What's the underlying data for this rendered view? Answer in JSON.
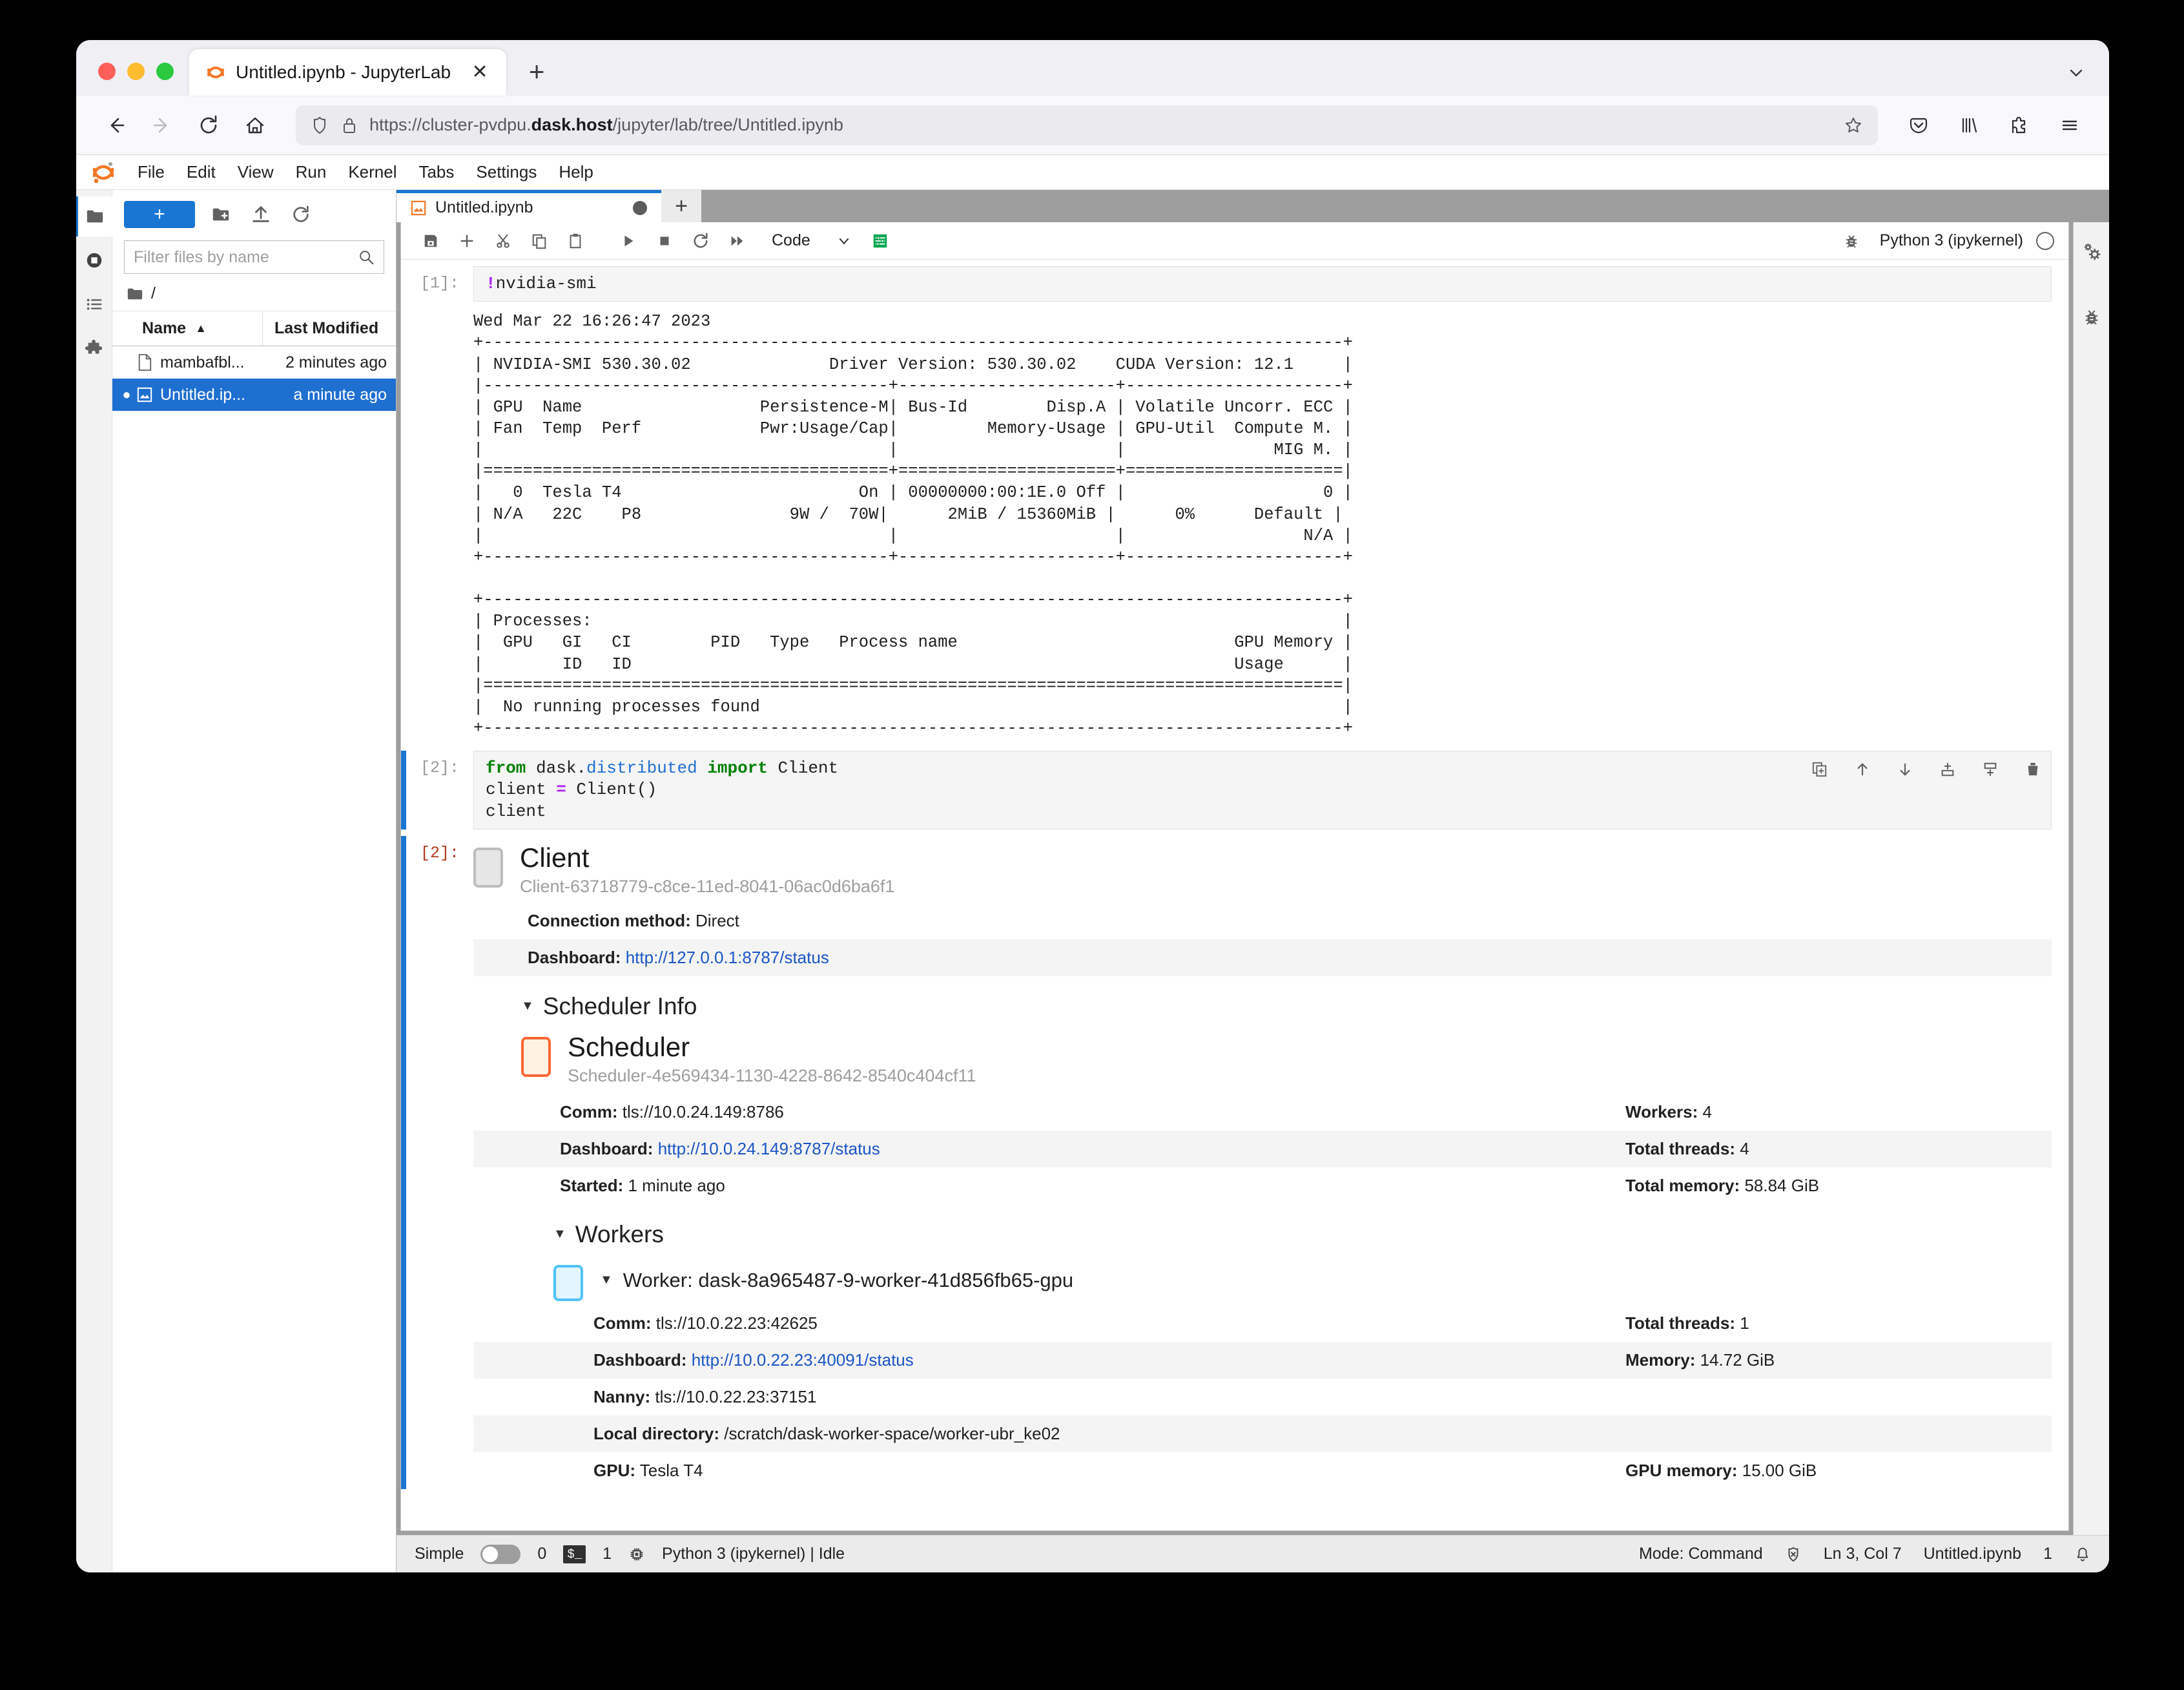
{
  "browser": {
    "tab": {
      "title": "Untitled.ipynb - JupyterLab",
      "favicon": "jupyter-logo-icon",
      "close": "✕"
    },
    "new_tab_label": "+",
    "url_prefix": "https://cluster-pvdpu.",
    "url_bold": "dask.host",
    "url_suffix": "/jupyter/lab/tree/Untitled.ipynb",
    "nav": {
      "back": "back-icon",
      "forward": "forward-icon",
      "reload": "reload-icon",
      "home": "home-icon"
    },
    "toolbar_right": [
      "pocket-icon",
      "library-icon",
      "extensions-icon",
      "app-menu-icon"
    ]
  },
  "jupyter": {
    "menu": [
      "File",
      "Edit",
      "View",
      "Run",
      "Kernel",
      "Tabs",
      "Settings",
      "Help"
    ],
    "left_rail": [
      "folder-icon",
      "running-icon",
      "commands-icon",
      "extensions-icon"
    ],
    "right_rail": [
      "property-inspector-icon",
      "debugger-icon"
    ],
    "filebrowser": {
      "new_button": "+",
      "new_folder_icon": "new-folder-icon",
      "upload_icon": "upload-icon",
      "refresh_icon": "refresh-icon",
      "filter_placeholder": "Filter files by name",
      "filter_value": "",
      "breadcrumb": "/",
      "columns": [
        "Name",
        "Last Modified"
      ],
      "sort_indicator": "▲",
      "files": [
        {
          "name": "mambafbl...",
          "modified": "2 minutes ago",
          "icon": "file-icon",
          "selected": false,
          "dirty": false
        },
        {
          "name": "Untitled.ip...",
          "modified": "a minute ago",
          "icon": "notebook-icon",
          "selected": true,
          "dirty": true
        }
      ]
    },
    "notebook": {
      "tab_label": "Untitled.ipynb",
      "tab_add": "+",
      "toolbar_icons": [
        "save-icon",
        "insert-cell-icon",
        "cut-icon",
        "copy-icon",
        "paste-icon",
        "run-icon",
        "stop-icon",
        "restart-icon",
        "restart-run-all-icon"
      ],
      "cell_type": "Code",
      "cell_type_caret": "⌄",
      "render_icon": "render-toggle-icon",
      "debugger_icon": "debugger-bug-icon",
      "kernel_name": "Python 3 (ipykernel)",
      "kernel_status": "idle-circle-icon",
      "cell_actions": [
        "duplicate-cell-icon",
        "move-cell-up-icon",
        "move-cell-down-icon",
        "insert-cell-above-icon",
        "insert-cell-below-icon",
        "delete-cell-icon"
      ]
    },
    "statusbar": {
      "simple_label": "Simple",
      "simple_on": false,
      "kernel_count": "0",
      "terminal_badge": "$_",
      "terminal_count": "1",
      "cpu_icon": "cpu-icon",
      "kernel_status": "Python 3 (ipykernel) | Idle",
      "mode": "Mode: Command",
      "no_issues_icon": "shield-x-icon",
      "cursor": "Ln 3, Col 7",
      "filename": "Untitled.ipynb",
      "notification_count": "1",
      "bell_icon": "bell-icon"
    }
  },
  "cells": [
    {
      "prompt": "[1]:",
      "code_bang": "!",
      "code_rest": "nvidia-smi",
      "output": "Wed Mar 22 16:26:47 2023       \n+---------------------------------------------------------------------------------------+\n| NVIDIA-SMI 530.30.02              Driver Version: 530.30.02    CUDA Version: 12.1     |\n|-----------------------------------------+----------------------+----------------------+\n| GPU  Name                  Persistence-M| Bus-Id        Disp.A | Volatile Uncorr. ECC |\n| Fan  Temp  Perf            Pwr:Usage/Cap|         Memory-Usage | GPU-Util  Compute M. |\n|                                         |                      |               MIG M. |\n|=========================================+======================+======================|\n|   0  Tesla T4                        On | 00000000:00:1E.0 Off |                    0 |\n| N/A   22C    P8               9W /  70W|      2MiB / 15360MiB |      0%      Default |\n|                                         |                      |                  N/A |\n+-----------------------------------------+----------------------+----------------------+\n                                                                                         \n+---------------------------------------------------------------------------------------+\n| Processes:                                                                            |\n|  GPU   GI   CI        PID   Type   Process name                            GPU Memory |\n|        ID   ID                                                             Usage      |\n|=======================================================================================|\n|  No running processes found                                                           |\n+---------------------------------------------------------------------------------------+"
    },
    {
      "prompt": "[2]:",
      "line1_from": "from",
      "line1_mod": " dask.",
      "line1_sub": "distributed",
      "line1_import": " import",
      "line1_cls": " Client",
      "line2_a": "client ",
      "line2_eq": "=",
      "line2_b": " Client()",
      "line3": "client"
    }
  ],
  "dask_output": {
    "prompt": "[2]:",
    "client_title": "Client",
    "client_id": "Client-63718779-c8ce-11ed-8041-06ac0d6ba6f1",
    "connection_label": "Connection method:",
    "connection_value": "Direct",
    "dashboard_label": "Dashboard:",
    "dashboard_url": "http://127.0.0.1:8787/status",
    "scheduler_info_title": "Scheduler Info",
    "scheduler": {
      "title": "Scheduler",
      "id": "Scheduler-4e569434-1130-4228-8642-8540c404cf11",
      "rows": [
        {
          "left_label": "Comm:",
          "left_value": "tls://10.0.24.149:8786",
          "right_label": "Workers:",
          "right_value": "4",
          "link": false
        },
        {
          "left_label": "Dashboard:",
          "left_value": "http://10.0.24.149:8787/status",
          "right_label": "Total threads:",
          "right_value": "4",
          "link": true
        },
        {
          "left_label": "Started:",
          "left_value": "1 minute ago",
          "right_label": "Total memory:",
          "right_value": "58.84 GiB",
          "link": false
        }
      ]
    },
    "workers_title": "Workers",
    "worker": {
      "title": "Worker: dask-8a965487-9-worker-41d856fb65-gpu",
      "rows": [
        {
          "left_label": "Comm:",
          "left_value": "tls://10.0.22.23:42625",
          "right_label": "Total threads:",
          "right_value": "1",
          "link": false
        },
        {
          "left_label": "Dashboard:",
          "left_value": "http://10.0.22.23:40091/status",
          "right_label": "Memory:",
          "right_value": "14.72 GiB",
          "link": true
        },
        {
          "left_label": "Nanny:",
          "left_value": "tls://10.0.22.23:37151",
          "right_label": "",
          "right_value": "",
          "link": false
        },
        {
          "left_label": "Local directory:",
          "left_value": "/scratch/dask-worker-space/worker-ubr_ke02",
          "right_label": "",
          "right_value": "",
          "link": false
        },
        {
          "left_label": "GPU:",
          "left_value": "Tesla T4",
          "right_label": "GPU memory:",
          "right_value": "15.00 GiB",
          "link": false
        }
      ]
    }
  },
  "colors": {
    "accent": "#1976d2",
    "jupyter_orange": "#f37726",
    "link": "#1a56c4",
    "scheduler": "#ff6633",
    "worker": "#4fc3f7"
  }
}
